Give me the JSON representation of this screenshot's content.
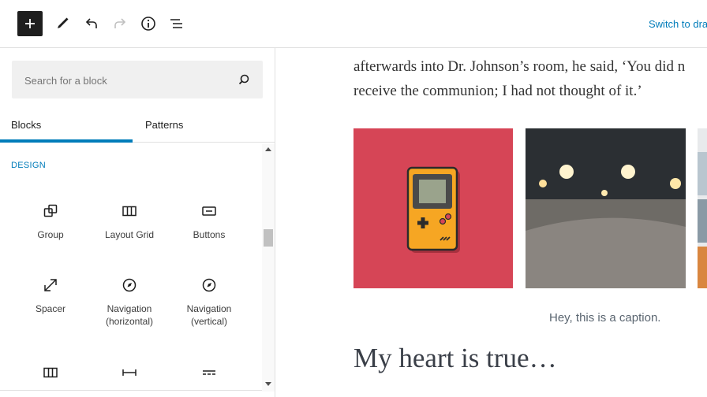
{
  "toolbar": {
    "switch_label": "Switch to dra"
  },
  "sidebar": {
    "search_placeholder": "Search for a block",
    "tabs": [
      {
        "label": "Blocks"
      },
      {
        "label": "Patterns"
      }
    ],
    "category": "DESIGN",
    "blocks": [
      {
        "label": "Group",
        "icon": "group-icon"
      },
      {
        "label": "Layout Grid",
        "icon": "layout-grid-icon"
      },
      {
        "label": "Buttons",
        "icon": "buttons-icon"
      },
      {
        "label": "Spacer",
        "icon": "spacer-icon"
      },
      {
        "label": "Navigation (horizontal)",
        "icon": "compass-icon"
      },
      {
        "label": "Navigation (vertical)",
        "icon": "compass-icon"
      }
    ]
  },
  "editor": {
    "paragraph_line1": "afterwards into Dr. Johnson’s room, he said, ‘You did n",
    "paragraph_line2": "receive the communion; I had not thought of it.’",
    "caption": "Hey, this is a caption.",
    "heading": "My heart is true…"
  },
  "colors": {
    "accent": "#007cba",
    "image1_bg": "#d64556"
  }
}
